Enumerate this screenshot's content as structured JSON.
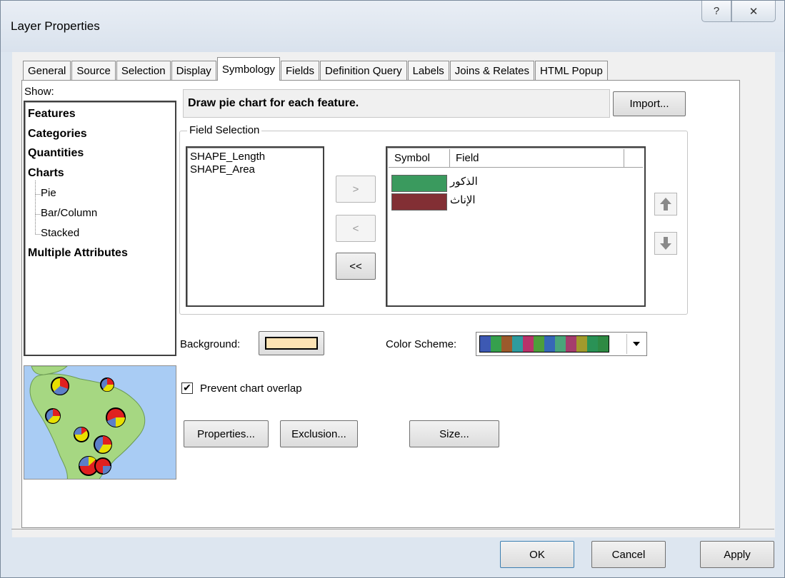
{
  "window": {
    "title": "Layer Properties",
    "help_glyph": "?",
    "close_glyph": "✕"
  },
  "tabs": [
    {
      "label": "General",
      "active": false
    },
    {
      "label": "Source",
      "active": false
    },
    {
      "label": "Selection",
      "active": false
    },
    {
      "label": "Display",
      "active": false
    },
    {
      "label": "Symbology",
      "active": true
    },
    {
      "label": "Fields",
      "active": false
    },
    {
      "label": "Definition Query",
      "active": false
    },
    {
      "label": "Labels",
      "active": false
    },
    {
      "label": "Joins & Relates",
      "active": false
    },
    {
      "label": "HTML Popup",
      "active": false
    }
  ],
  "show": {
    "label": "Show:",
    "items": [
      {
        "label": "Features",
        "bold": true
      },
      {
        "label": "Categories",
        "bold": true
      },
      {
        "label": "Quantities",
        "bold": true
      },
      {
        "label": "Charts",
        "bold": true
      },
      {
        "label": "Pie",
        "bold": false,
        "selected": true
      },
      {
        "label": "Bar/Column",
        "bold": false
      },
      {
        "label": "Stacked",
        "bold": false
      },
      {
        "label": "Multiple Attributes",
        "bold": true
      }
    ]
  },
  "description": "Draw pie chart for each feature.",
  "import_button": "Import...",
  "field_selection": {
    "caption": "Field Selection",
    "available": [
      "SHAPE_Length",
      "SHAPE_Area"
    ],
    "add_button": ">",
    "remove_button": "<",
    "remove_all_button": "<<",
    "columns": {
      "symbol": "Symbol",
      "field": "Field"
    },
    "selected": [
      {
        "field": "الذكور",
        "color": "#3a9a5e"
      },
      {
        "field": "الإناث",
        "color": "#822f34"
      }
    ]
  },
  "background": {
    "label": "Background:",
    "color": "#fde3b4"
  },
  "color_scheme": {
    "label": "Color  Scheme:",
    "colors": [
      "#3d59b3",
      "#36a04d",
      "#9b5a2c",
      "#2e9b9e",
      "#b8336a",
      "#4d9e3b",
      "#3667b7",
      "#4aa57a",
      "#a53d6d",
      "#a29a2c",
      "#2a9256",
      "#2e8a43"
    ]
  },
  "prevent_overlap": {
    "label": "Prevent chart overlap",
    "checked": true
  },
  "buttons": {
    "properties": "Properties...",
    "exclusion": "Exclusion...",
    "size": "Size...",
    "ok": "OK",
    "cancel": "Cancel",
    "apply": "Apply"
  }
}
